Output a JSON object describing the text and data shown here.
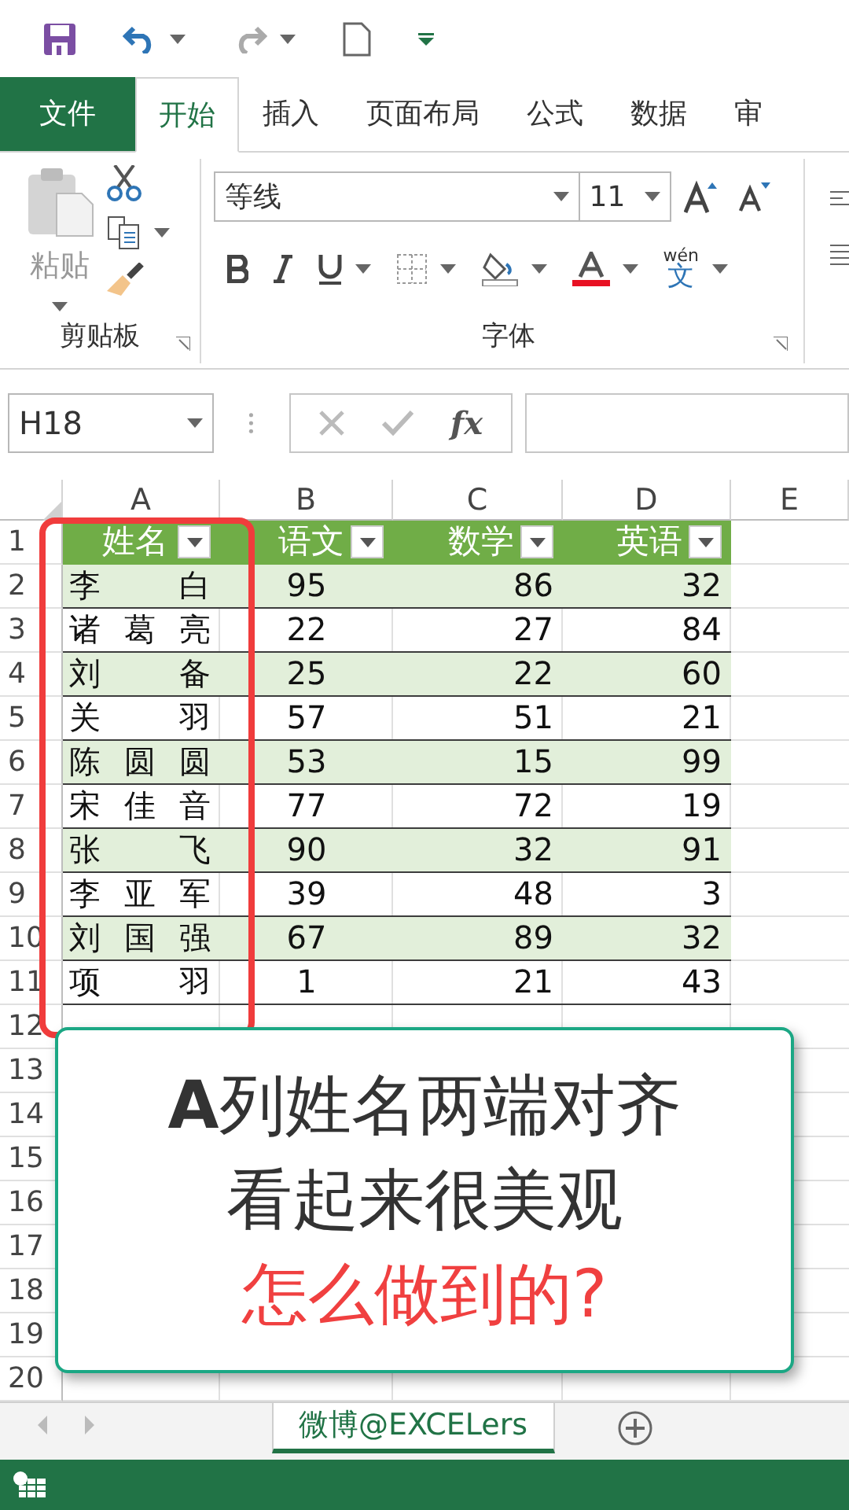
{
  "ribbon_tabs": [
    {
      "label": "文件",
      "kind": "file",
      "selected": false
    },
    {
      "label": "开始",
      "kind": "tab",
      "selected": true
    },
    {
      "label": "插入",
      "kind": "tab",
      "selected": false
    },
    {
      "label": "页面布局",
      "kind": "tab",
      "selected": false
    },
    {
      "label": "公式",
      "kind": "tab",
      "selected": false
    },
    {
      "label": "数据",
      "kind": "tab",
      "selected": false
    },
    {
      "label": "审",
      "kind": "tab",
      "selected": false
    }
  ],
  "clipboard_group": {
    "paste_label": "粘贴",
    "label": "剪贴板"
  },
  "font_group": {
    "font_name": "等线",
    "font_size": "11",
    "phonetic_pinyin": "wén",
    "phonetic_char": "文",
    "label": "字体"
  },
  "formula_bar": {
    "name_box": "H18",
    "function_label": "fx"
  },
  "sheet": {
    "columns": [
      "A",
      "B",
      "C",
      "D",
      "E"
    ],
    "header": [
      "姓名",
      "语文",
      "数学",
      "英语"
    ],
    "rows": [
      [
        "李白",
        "95",
        "86",
        "32"
      ],
      [
        "诸葛亮",
        "22",
        "27",
        "84"
      ],
      [
        "刘备",
        "25",
        "22",
        "60"
      ],
      [
        "关羽",
        "57",
        "51",
        "21"
      ],
      [
        "陈圆圆",
        "53",
        "15",
        "99"
      ],
      [
        "宋佳音",
        "77",
        "72",
        "19"
      ],
      [
        "张飞",
        "90",
        "32",
        "91"
      ],
      [
        "李亚军",
        "39",
        "48",
        "3"
      ],
      [
        "刘国强",
        "67",
        "89",
        "32"
      ],
      [
        "项羽",
        "1",
        "21",
        "43"
      ]
    ],
    "row_numbers": [
      "1",
      "2",
      "3",
      "4",
      "5",
      "6",
      "7",
      "8",
      "9",
      "10",
      "11",
      "12",
      "13",
      "14",
      "15",
      "16",
      "17",
      "18",
      "19",
      "20"
    ]
  },
  "callout": {
    "lines": [
      {
        "text": "**A**列姓名两端对齐",
        "kind": "normal"
      },
      {
        "text": "看起来很美观",
        "kind": "normal"
      },
      {
        "text": "怎么做到的?",
        "kind": "accent"
      }
    ]
  },
  "sheet_tabs": [
    {
      "label": "微博@EXCELers",
      "selected": true
    }
  ]
}
